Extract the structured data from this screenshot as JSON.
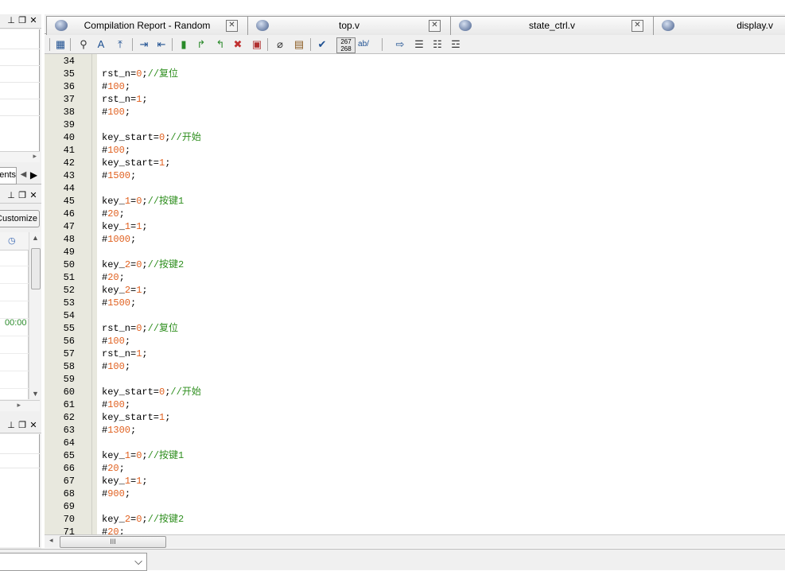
{
  "tabs": [
    {
      "label": "Compilation Report - Random",
      "icon": "compilation-report-icon"
    },
    {
      "label": "top.v",
      "icon": "verilog-file-icon"
    },
    {
      "label": "state_ctrl.v",
      "icon": "verilog-file-icon"
    },
    {
      "label": "display.v",
      "icon": "verilog-file-icon"
    }
  ],
  "left_panels": {
    "components_tab_label": "Components",
    "customize_button": "Customize...",
    "grid_time": "00:00"
  },
  "status": {
    "scroll_thumb_text": "III",
    "combo_value": ""
  },
  "code_lines": [
    {
      "n": "34",
      "c": ""
    },
    {
      "n": "35",
      "c": "rst_n=0;//复位"
    },
    {
      "n": "36",
      "c": "#100;"
    },
    {
      "n": "37",
      "c": "rst_n=1;"
    },
    {
      "n": "38",
      "c": "#100;"
    },
    {
      "n": "39",
      "c": ""
    },
    {
      "n": "40",
      "c": "key_start=0;//开始"
    },
    {
      "n": "41",
      "c": "#100;"
    },
    {
      "n": "42",
      "c": "key_start=1;"
    },
    {
      "n": "43",
      "c": "#1500;"
    },
    {
      "n": "44",
      "c": ""
    },
    {
      "n": "45",
      "c": "key_1=0;//按键1"
    },
    {
      "n": "46",
      "c": "#20;"
    },
    {
      "n": "47",
      "c": "key_1=1;"
    },
    {
      "n": "48",
      "c": "#1000;"
    },
    {
      "n": "49",
      "c": ""
    },
    {
      "n": "50",
      "c": "key_2=0;//按键2"
    },
    {
      "n": "51",
      "c": "#20;"
    },
    {
      "n": "52",
      "c": "key_2=1;"
    },
    {
      "n": "53",
      "c": "#1500;"
    },
    {
      "n": "54",
      "c": ""
    },
    {
      "n": "55",
      "c": "rst_n=0;//复位"
    },
    {
      "n": "56",
      "c": "#100;"
    },
    {
      "n": "57",
      "c": "rst_n=1;"
    },
    {
      "n": "58",
      "c": "#100;"
    },
    {
      "n": "59",
      "c": ""
    },
    {
      "n": "60",
      "c": "key_start=0;//开始"
    },
    {
      "n": "61",
      "c": "#100;"
    },
    {
      "n": "62",
      "c": "key_start=1;"
    },
    {
      "n": "63",
      "c": "#1300;"
    },
    {
      "n": "64",
      "c": ""
    },
    {
      "n": "65",
      "c": "key_1=0;//按键1"
    },
    {
      "n": "66",
      "c": "#20;"
    },
    {
      "n": "67",
      "c": "key_1=1;"
    },
    {
      "n": "68",
      "c": "#900;"
    },
    {
      "n": "69",
      "c": ""
    },
    {
      "n": "70",
      "c": "key_2=0;//按键2"
    },
    {
      "n": "71",
      "c": "#20;"
    }
  ],
  "colors": {
    "number": "#e0601f",
    "comment": "#2f8f1f",
    "gutter": "#e8e8de"
  }
}
